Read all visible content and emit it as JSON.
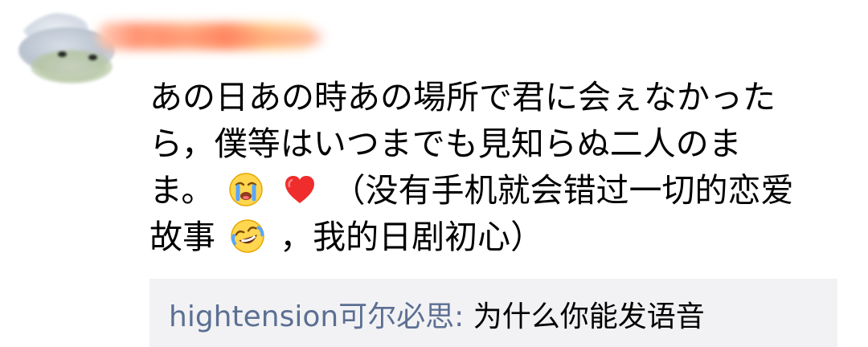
{
  "comment": {
    "line1": "あの日あの時あの場所で君に会ぇなかった",
    "line2": "ら，僕等はいつまでも見知らぬ二人のま",
    "line3_prefix": "ま。",
    "line3_suffix": " （没有手机就会错过一切的恋爱",
    "line4_prefix": "故事",
    "line4_suffix": "，我的日剧初心）"
  },
  "emojis": {
    "crying": "crying-face-emoji",
    "heart": "red-heart-emoji",
    "laughing": "rolling-laughing-emoji"
  },
  "reply": {
    "author": "hightension可尔必思",
    "colon": ":",
    "text": " 为什么你能发语音"
  },
  "colors": {
    "reply_author": "#5c6f93",
    "reply_background": "#f2f2f4",
    "text": "#000000"
  }
}
